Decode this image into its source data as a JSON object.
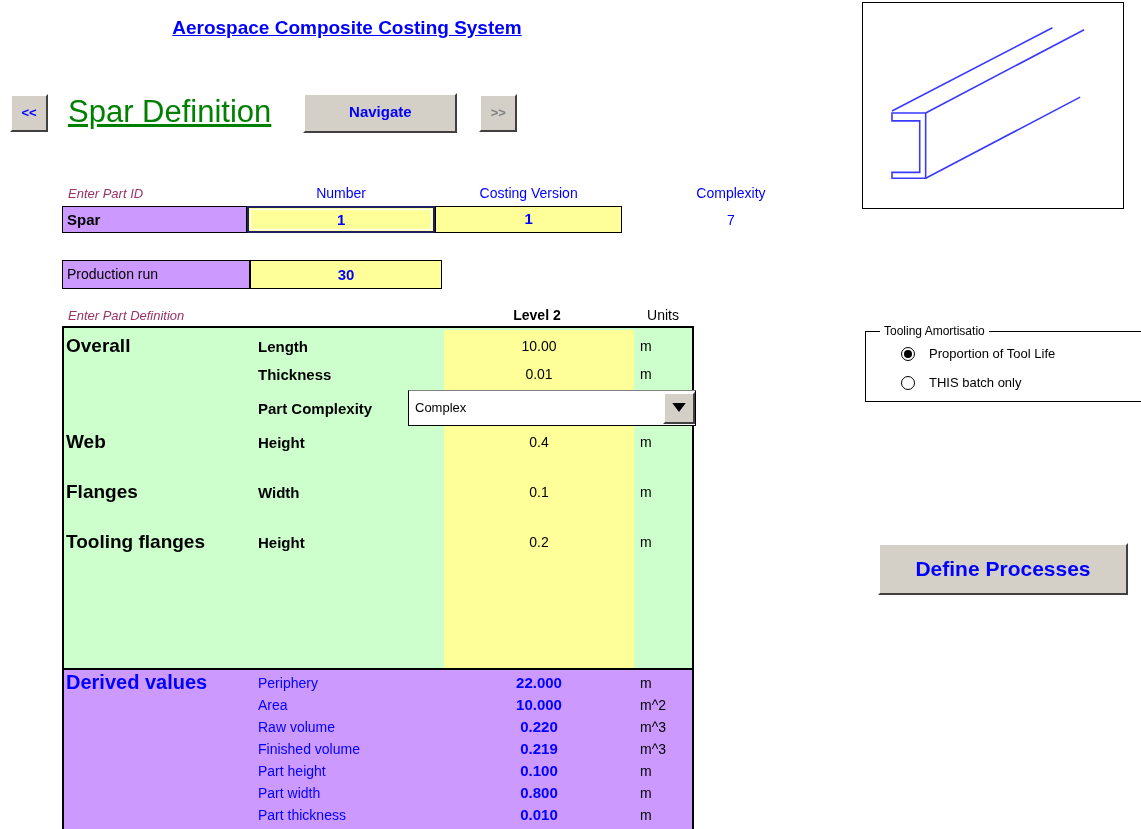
{
  "header": {
    "title": "Aerospace Composite Costing System"
  },
  "nav": {
    "back": {
      "label": "<<",
      "disabled": false
    },
    "page_title": "Spar Definition",
    "navigate": "Navigate",
    "forward": {
      "label": ">>",
      "disabled": true
    }
  },
  "part_id": {
    "hint": "Enter Part ID",
    "columns": [
      "Number",
      "Costing Version",
      "Complexity"
    ],
    "name": "Spar",
    "cells": [
      {
        "value": "1",
        "selected": true
      },
      {
        "value": "1",
        "selected": false
      }
    ],
    "complexity": "7"
  },
  "production_run": {
    "label": "Production run",
    "value": "30"
  },
  "definition": {
    "hint": "Enter Part Definition",
    "level_heading": "Level 2",
    "units_heading": "Units",
    "rows": [
      {
        "kind": "value",
        "group": "Overall",
        "label": "Length",
        "value": "10.00",
        "unit": "m"
      },
      {
        "kind": "value",
        "label": "Thickness",
        "value": "0.01",
        "unit": "m"
      },
      {
        "kind": "dropdown",
        "label": "Part Complexity",
        "value": "Complex"
      },
      {
        "kind": "value",
        "group": "Web",
        "label": "Height",
        "value": "0.4",
        "unit": "m"
      },
      {
        "kind": "value",
        "group": "Flanges",
        "label": "Width",
        "value": "0.1",
        "unit": "m"
      },
      {
        "kind": "value",
        "group": "Tooling flanges",
        "label": "Height",
        "value": "0.2",
        "unit": "m"
      }
    ]
  },
  "derived": {
    "title": "Derived values",
    "rows": [
      {
        "label": "Periphery",
        "value": "22.000",
        "unit": "m"
      },
      {
        "label": "Area",
        "value": "10.000",
        "unit": "m^2"
      },
      {
        "label": "Raw volume",
        "value": "0.220",
        "unit": "m^3"
      },
      {
        "label": "Finished volume",
        "value": "0.219",
        "unit": "m^3"
      },
      {
        "label": "Part height",
        "value": "0.100",
        "unit": "m"
      },
      {
        "label": "Part width",
        "value": "0.800",
        "unit": "m"
      },
      {
        "label": "Part thickness",
        "value": "0.010",
        "unit": "m"
      }
    ]
  },
  "tooling": {
    "legend": "Tooling Amortisatio",
    "options": [
      {
        "label": "Proportion of Tool Life",
        "selected": true
      },
      {
        "label": "THIS batch only",
        "selected": false
      }
    ]
  },
  "define_button": "Define Processes"
}
